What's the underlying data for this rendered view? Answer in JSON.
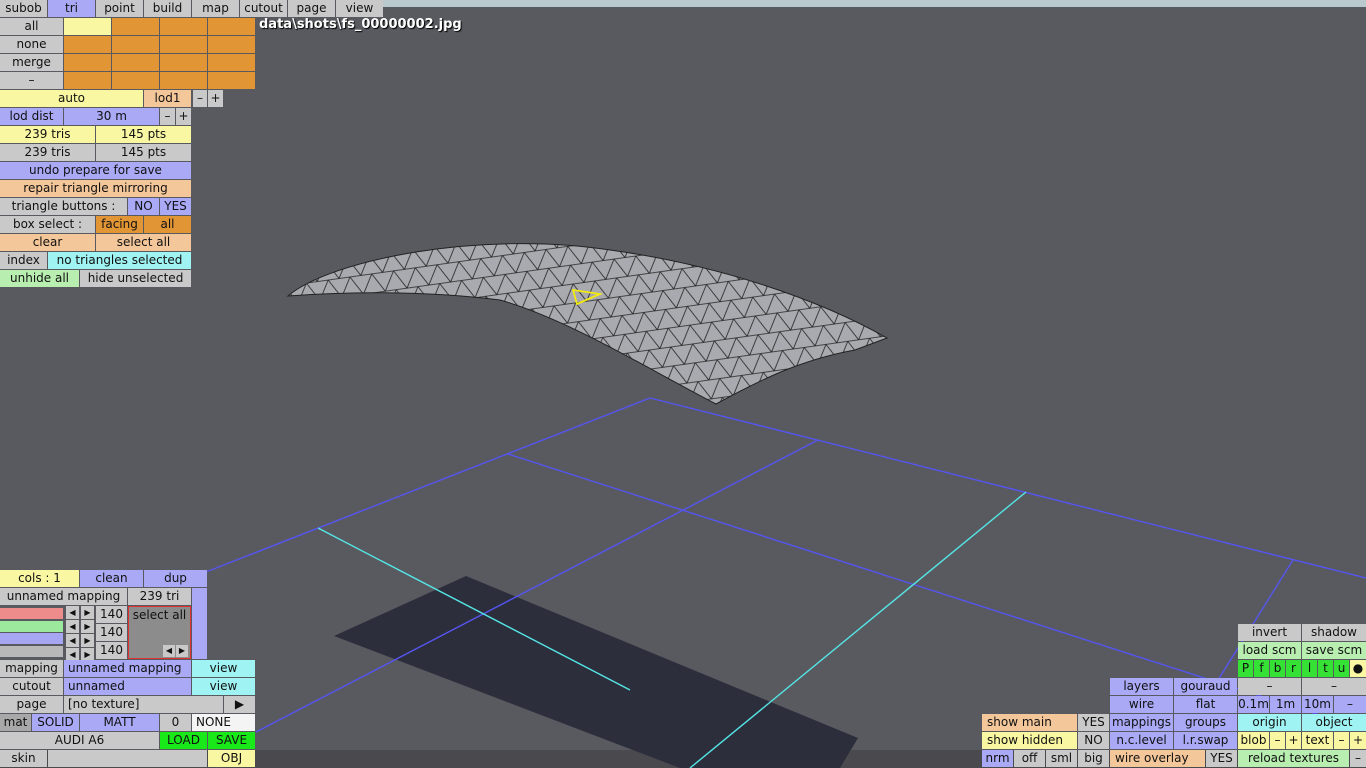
{
  "menu": [
    "subob",
    "tri",
    "point",
    "build",
    "map",
    "cutout",
    "page",
    "view"
  ],
  "filename": "data\\shots\\fs_00000002.jpg",
  "left": {
    "sel_all": "all",
    "sel_none": "none",
    "sel_merge": "merge",
    "sel_dash": "–",
    "auto": "auto",
    "lod1": "lod1",
    "minus": "–",
    "plus": "+",
    "lod_dist": "lod dist",
    "lod_dist_val": "30 m",
    "tris1": "239 tris",
    "pts1": "145 pts",
    "tris2": "239 tris",
    "pts2": "145 pts",
    "undo_prep": "undo prepare for save",
    "repair": "repair triangle mirroring",
    "tri_buttons": "triangle buttons :",
    "no": "NO",
    "yes": "YES",
    "box_select": "box select :",
    "facing": "facing",
    "all": "all",
    "clear": "clear",
    "select_all": "select all",
    "index": "index",
    "no_tri": "no triangles selected",
    "unhide_all": "unhide all",
    "hide_unselected": "hide unselected"
  },
  "mat": {
    "cols": "cols : 1",
    "clean": "clean",
    "dup": "dup",
    "mapping_name": "unnamed mapping",
    "tri_count": "239 tri",
    "rgb": [
      "140",
      "140",
      "140"
    ],
    "select_all": "select all",
    "mapping": "mapping",
    "mapping_val": "unnamed mapping",
    "view": "view",
    "cutout": "cutout",
    "cutout_val": "unnamed",
    "view2": "view",
    "page": "page",
    "page_val": "[no texture]",
    "arrow": "▶",
    "mat": "mat",
    "solid": "SOLID",
    "matt": "MATT",
    "zero": "0",
    "none": "NONE",
    "audi": "AUDI A6",
    "load": "LOAD",
    "save": "SAVE",
    "skin": "skin",
    "obj": "OBJ"
  },
  "right": {
    "invert": "invert",
    "shadow": "shadow",
    "load_scm": "load scm",
    "save_scm": "save scm",
    "letters": [
      "P",
      "f",
      "b",
      "r",
      "l",
      "t",
      "u",
      "●"
    ],
    "layers": "layers",
    "gouraud": "gouraud",
    "dash": "–",
    "wire": "wire",
    "flat": "flat",
    "s01": "0.1m",
    "s1": "1m",
    "s10": "10m",
    "show_main": "show main",
    "yes": "YES",
    "mappings": "mappings",
    "groups": "groups",
    "origin": "origin",
    "object": "object",
    "show_hidden": "show hidden",
    "no": "NO",
    "nclevel": "n.c.level",
    "lrswap": "l.r.swap",
    "blob": "blob",
    "text": "text",
    "plus": "+",
    "nrm": "nrm",
    "off": "off",
    "sml": "sml",
    "big": "big",
    "wire_overlay": "wire overlay",
    "reload": "reload textures"
  }
}
